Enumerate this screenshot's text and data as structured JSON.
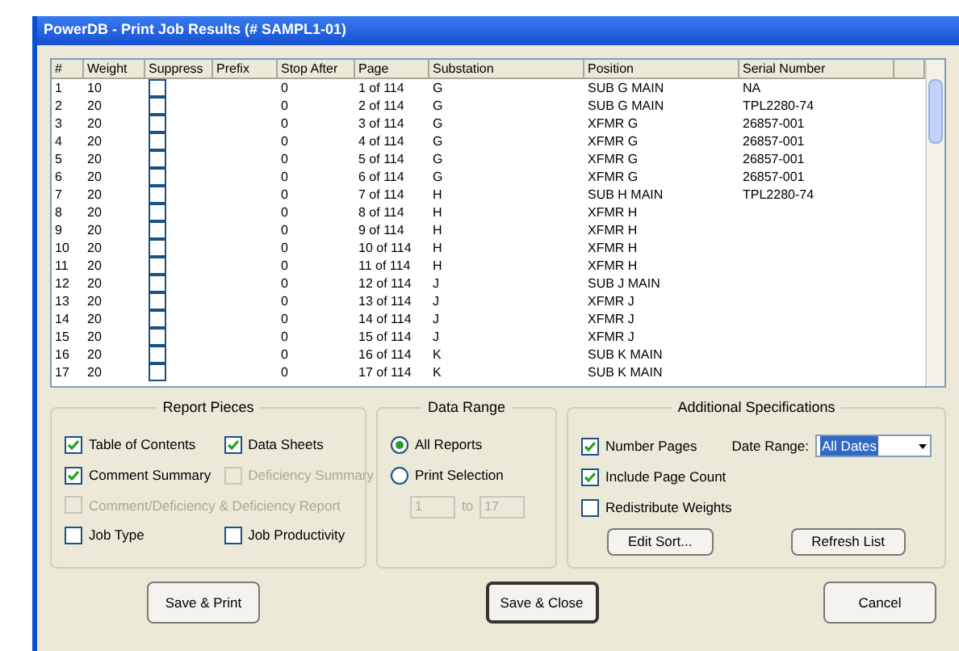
{
  "window": {
    "title": "PowerDB - Print Job Results (# SAMPL1-01)"
  },
  "table": {
    "columns": [
      "#",
      "Weight",
      "Suppress",
      "Prefix",
      "Stop After",
      "Page",
      "Substation",
      "Position",
      "Serial Number",
      ""
    ],
    "rows": [
      {
        "num": "1",
        "weight": "10",
        "suppress": false,
        "stop_after": "0",
        "page": "1 of 114",
        "substation": "G",
        "position": "SUB G MAIN",
        "serial": "NA"
      },
      {
        "num": "2",
        "weight": "20",
        "suppress": false,
        "stop_after": "0",
        "page": "2 of 114",
        "substation": "G",
        "position": "SUB G MAIN",
        "serial": "TPL2280-74"
      },
      {
        "num": "3",
        "weight": "20",
        "suppress": false,
        "stop_after": "0",
        "page": "3 of 114",
        "substation": "G",
        "position": "XFMR G",
        "serial": "26857-001"
      },
      {
        "num": "4",
        "weight": "20",
        "suppress": false,
        "stop_after": "0",
        "page": "4 of 114",
        "substation": "G",
        "position": "XFMR G",
        "serial": "26857-001"
      },
      {
        "num": "5",
        "weight": "20",
        "suppress": false,
        "stop_after": "0",
        "page": "5 of 114",
        "substation": "G",
        "position": "XFMR G",
        "serial": "26857-001"
      },
      {
        "num": "6",
        "weight": "20",
        "suppress": false,
        "stop_after": "0",
        "page": "6 of 114",
        "substation": "G",
        "position": "XFMR G",
        "serial": "26857-001"
      },
      {
        "num": "7",
        "weight": "20",
        "suppress": false,
        "stop_after": "0",
        "page": "7 of 114",
        "substation": "H",
        "position": "SUB H MAIN",
        "serial": "TPL2280-74"
      },
      {
        "num": "8",
        "weight": "20",
        "suppress": false,
        "stop_after": "0",
        "page": "8 of 114",
        "substation": "H",
        "position": "XFMR H",
        "serial": ""
      },
      {
        "num": "9",
        "weight": "20",
        "suppress": false,
        "stop_after": "0",
        "page": "9 of 114",
        "substation": "H",
        "position": "XFMR H",
        "serial": ""
      },
      {
        "num": "10",
        "weight": "20",
        "suppress": false,
        "stop_after": "0",
        "page": "10 of 114",
        "substation": "H",
        "position": "XFMR H",
        "serial": ""
      },
      {
        "num": "11",
        "weight": "20",
        "suppress": false,
        "stop_after": "0",
        "page": "11 of 114",
        "substation": "H",
        "position": "XFMR H",
        "serial": ""
      },
      {
        "num": "12",
        "weight": "20",
        "suppress": false,
        "stop_after": "0",
        "page": "12 of 114",
        "substation": "J",
        "position": "SUB J MAIN",
        "serial": ""
      },
      {
        "num": "13",
        "weight": "20",
        "suppress": false,
        "stop_after": "0",
        "page": "13 of 114",
        "substation": "J",
        "position": "XFMR J",
        "serial": ""
      },
      {
        "num": "14",
        "weight": "20",
        "suppress": false,
        "stop_after": "0",
        "page": "14 of 114",
        "substation": "J",
        "position": "XFMR J",
        "serial": ""
      },
      {
        "num": "15",
        "weight": "20",
        "suppress": false,
        "stop_after": "0",
        "page": "15 of 114",
        "substation": "J",
        "position": "XFMR J",
        "serial": ""
      },
      {
        "num": "16",
        "weight": "20",
        "suppress": false,
        "stop_after": "0",
        "page": "16 of 114",
        "substation": "K",
        "position": "SUB K MAIN",
        "serial": ""
      },
      {
        "num": "17",
        "weight": "20",
        "suppress": false,
        "stop_after": "0",
        "page": "17 of 114",
        "substation": "K",
        "position": "SUB K MAIN",
        "serial": ""
      }
    ]
  },
  "report_pieces": {
    "title": "Report Pieces",
    "options": [
      {
        "label": "Table of Contents",
        "checked": true,
        "disabled": false
      },
      {
        "label": "Data Sheets",
        "checked": true,
        "disabled": false
      },
      {
        "label": "Comment Summary",
        "checked": true,
        "disabled": false
      },
      {
        "label": "Deficiency Summary",
        "checked": false,
        "disabled": true
      },
      {
        "label": "Comment/Deficiency & Deficiency Report",
        "checked": false,
        "disabled": true
      },
      {
        "label": "Job Type",
        "checked": false,
        "disabled": false
      },
      {
        "label": "Job Productivity",
        "checked": false,
        "disabled": false
      }
    ]
  },
  "data_range": {
    "title": "Data Range",
    "options": [
      {
        "label": "All Reports",
        "selected": true
      },
      {
        "label": "Print Selection",
        "selected": false
      }
    ],
    "from": {
      "value": "1",
      "disabled": true
    },
    "separator": "to",
    "to": {
      "value": "17",
      "disabled": true
    }
  },
  "additional": {
    "title": "Additional Specifications",
    "options": [
      {
        "label": "Number Pages",
        "checked": true
      },
      {
        "label": "Include Page Count",
        "checked": true
      },
      {
        "label": "Redistribute Weights",
        "checked": false
      }
    ],
    "date_range_label": "Date Range:",
    "date_range_value": "All Dates",
    "buttons": [
      "Edit Sort...",
      "Refresh List"
    ]
  },
  "buttons": [
    {
      "label": "Save & Print",
      "default": false
    },
    {
      "label": "Save & Close",
      "default": true
    },
    {
      "label": "Cancel",
      "default": false
    }
  ]
}
